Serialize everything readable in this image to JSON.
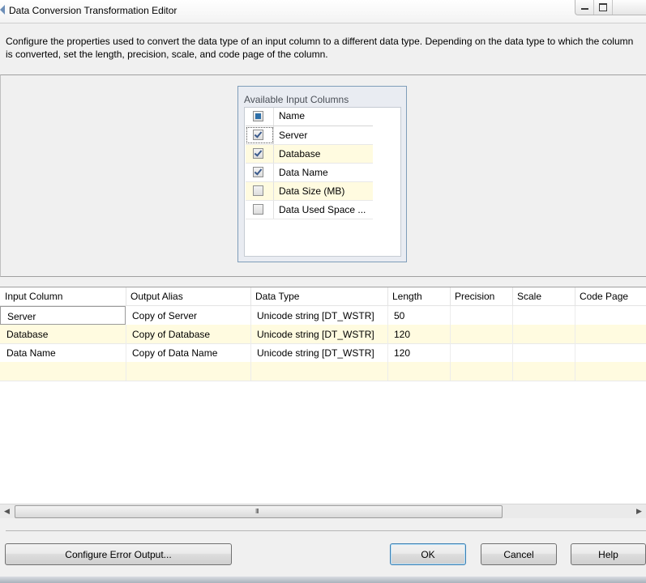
{
  "window": {
    "title": "Data Conversion Transformation Editor"
  },
  "description": "Configure the properties used to convert the data type of an input column to a different data type. Depending on the data type to which the column is converted, set the length, precision, scale, and code page of the column.",
  "available_columns": {
    "title": "Available Input Columns",
    "header_label": "Name",
    "items": [
      {
        "name": "Server",
        "checked": true
      },
      {
        "name": "Database",
        "checked": true
      },
      {
        "name": "Data Name",
        "checked": true
      },
      {
        "name": "Data Size (MB)",
        "checked": false
      },
      {
        "name": "Data Used Space ...",
        "checked": false
      }
    ]
  },
  "grid": {
    "columns": [
      "Input Column",
      "Output Alias",
      "Data Type",
      "Length",
      "Precision",
      "Scale",
      "Code Page"
    ],
    "rows": [
      [
        "Server",
        "Copy of Server",
        "Unicode string [DT_WSTR]",
        "50",
        "",
        "",
        ""
      ],
      [
        "Database",
        "Copy of Database",
        "Unicode string [DT_WSTR]",
        "120",
        "",
        "",
        ""
      ],
      [
        "Data Name",
        "Copy of Data Name",
        "Unicode string [DT_WSTR]",
        "120",
        "",
        "",
        ""
      ]
    ]
  },
  "scrollbar": {
    "grip": "III"
  },
  "buttons": {
    "configure_error_output": "Configure Error Output...",
    "ok": "OK",
    "cancel": "Cancel",
    "help": "Help"
  }
}
